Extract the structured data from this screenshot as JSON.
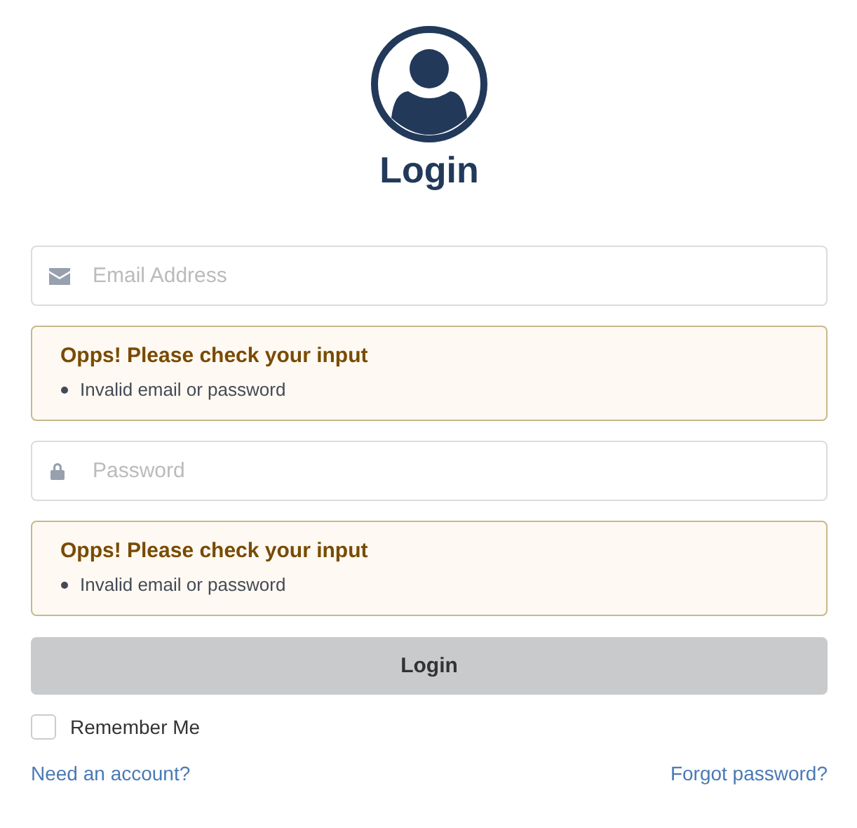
{
  "title": "Login",
  "fields": [
    {
      "kind": "email",
      "placeholder": "Email Address",
      "error": {
        "title": "Opps! Please check your input",
        "items": [
          "Invalid email or password"
        ]
      }
    },
    {
      "kind": "password",
      "placeholder": "Password",
      "error": {
        "title": "Opps! Please check your input",
        "items": [
          "Invalid email or password"
        ]
      }
    }
  ],
  "submit": {
    "label": "Login",
    "disabled": true
  },
  "remember": {
    "label": "Remember Me",
    "checked": false
  },
  "links": {
    "left": "Need an account?",
    "right": "Forgot password?"
  }
}
